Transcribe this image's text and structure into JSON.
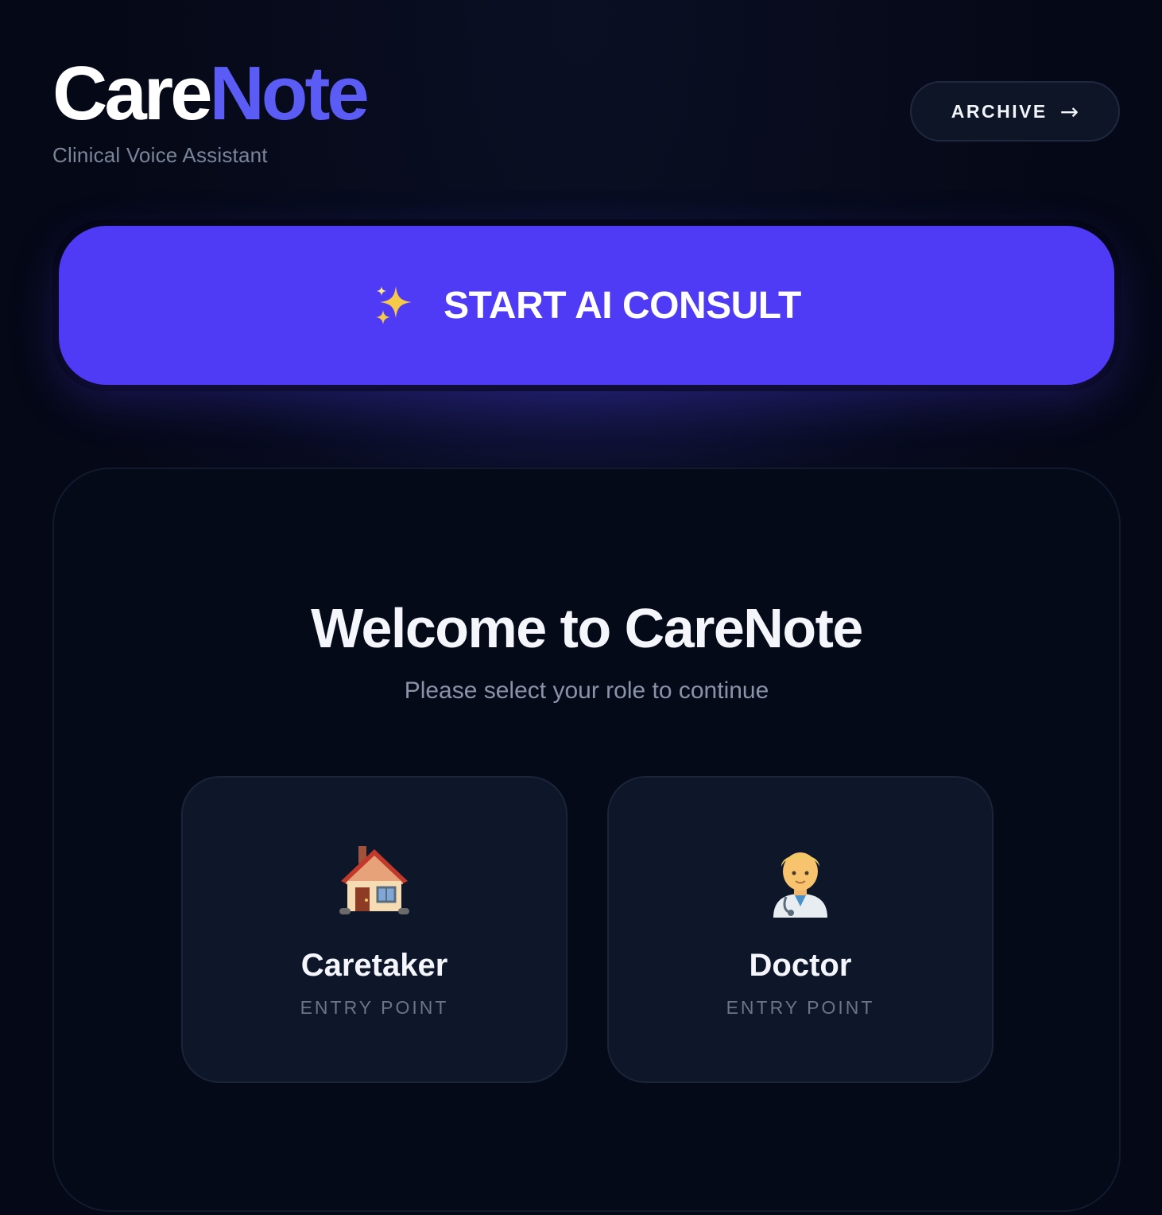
{
  "header": {
    "logo_part1": "Care",
    "logo_part2": "Note",
    "tagline": "Clinical Voice Assistant",
    "archive_label": "ARCHIVE",
    "archive_arrow": "→"
  },
  "consult": {
    "icon": "sparkles-icon",
    "label": "START AI CONSULT"
  },
  "welcome": {
    "title": "Welcome to CareNote",
    "subtitle": "Please select your role to continue",
    "roles": [
      {
        "icon": "house-icon",
        "name": "Caretaker",
        "subtitle": "ENTRY POINT"
      },
      {
        "icon": "doctor-icon",
        "name": "Doctor",
        "subtitle": "ENTRY POINT"
      }
    ]
  },
  "colors": {
    "background": "#050816",
    "accent": "#4f3bf6",
    "logo_accent": "#5b5cf6",
    "card": "#0e1629"
  }
}
